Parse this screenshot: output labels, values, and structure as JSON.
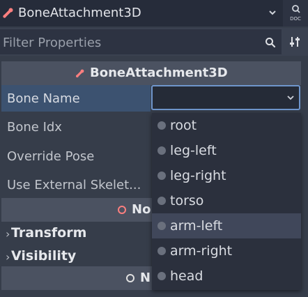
{
  "toolbar": {
    "class_name": "BoneAttachment3D",
    "class_icon": "bone-attachment-icon",
    "dropdown_icon": "chevron-down-icon",
    "doc_icon": "doc-magnifier-icon",
    "doc_text": "DOC"
  },
  "filter": {
    "placeholder": "Filter Properties",
    "search_icon": "search-icon",
    "tools_icon": "property-tools-icon"
  },
  "section": {
    "title": "BoneAttachment3D",
    "icon": "bone-attachment-icon"
  },
  "properties": [
    {
      "label": "Bone Name",
      "highlighted": true
    },
    {
      "label": "Bone Idx"
    },
    {
      "label": "Override Pose"
    },
    {
      "label": "Use External Skelet..."
    }
  ],
  "bone_name_field": {
    "value": ""
  },
  "node3d_section": {
    "title": "No",
    "icon": "node3d-circle-icon"
  },
  "groups": [
    {
      "label": "Transform"
    },
    {
      "label": "Visibility"
    }
  ],
  "node_section": {
    "title": "N",
    "icon": "node-circle-icon"
  },
  "dropdown": {
    "options": [
      "root",
      "leg-left",
      "leg-right",
      "torso",
      "arm-left",
      "arm-right",
      "head"
    ],
    "hovered": "arm-left"
  },
  "colors": {
    "accent": "#6f96cc",
    "bone_icon": "#fc7f7f",
    "node3d_icon": "#fc7f7f",
    "background": "#363d4a"
  }
}
